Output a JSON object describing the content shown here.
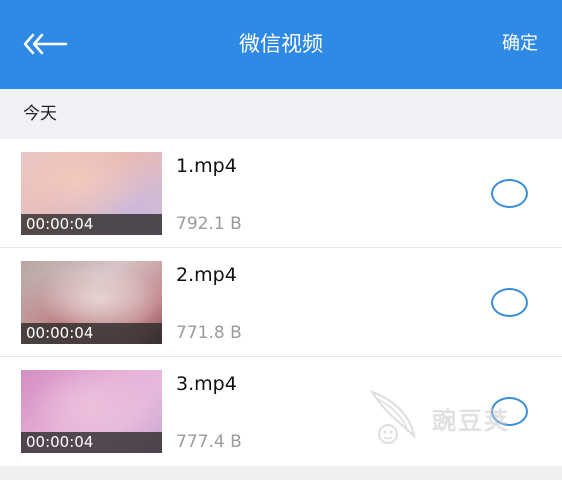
{
  "header": {
    "back_icon": "back-arrow-icon",
    "title": "微信视频",
    "confirm_label": "确定",
    "bg_color": "#2f8ae5"
  },
  "section": {
    "label": "今天"
  },
  "files": [
    {
      "name": "1.mp4",
      "size": "792.1 B",
      "duration": "00:00:04",
      "selected": false
    },
    {
      "name": "2.mp4",
      "size": "771.8 B",
      "duration": "00:00:04",
      "selected": false
    },
    {
      "name": "3.mp4",
      "size": "777.4 B",
      "duration": "00:00:04",
      "selected": false
    }
  ],
  "watermark": {
    "text": "豌豆荚",
    "icon": "pea-pod-logo-icon"
  }
}
